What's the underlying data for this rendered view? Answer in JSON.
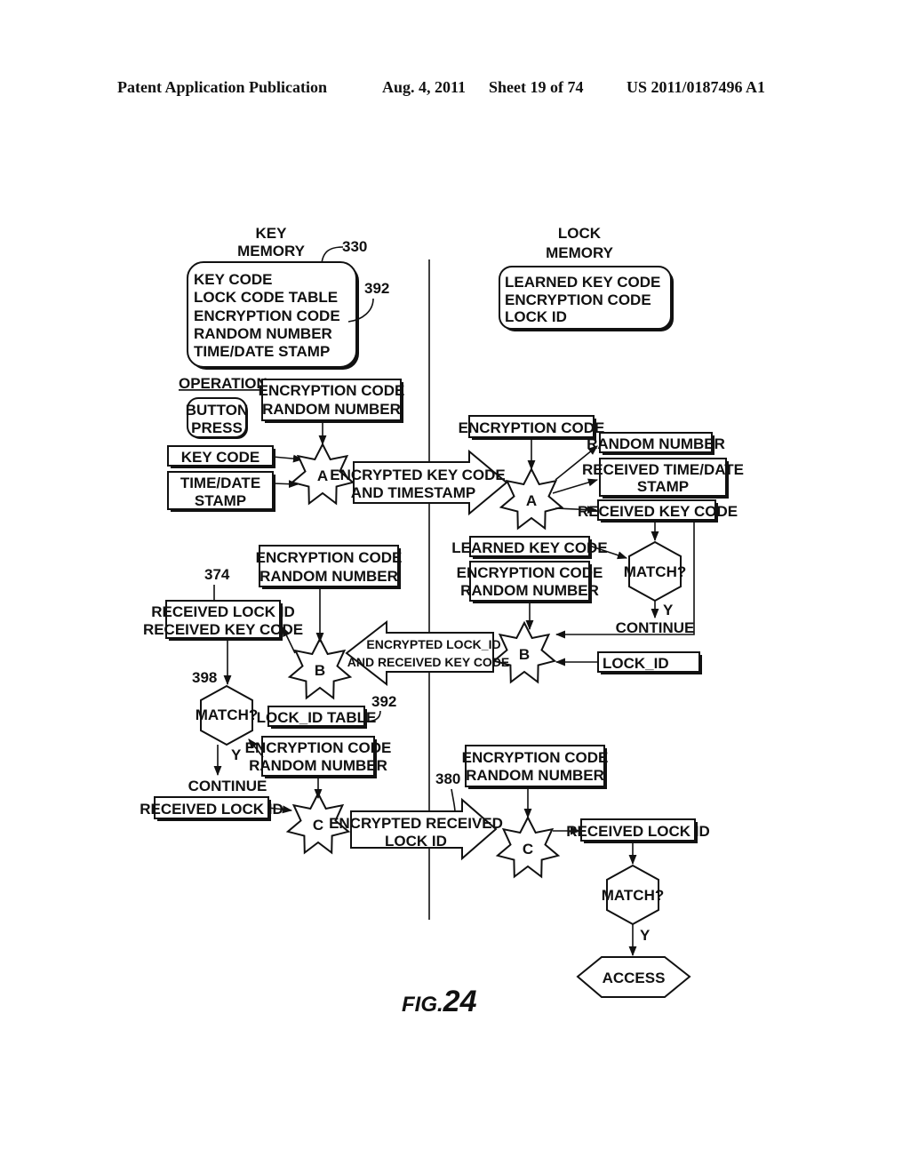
{
  "header": {
    "publication": "Patent Application Publication",
    "date": "Aug. 4, 2011",
    "sheet": "Sheet 19 of 74",
    "number": "US 2011/0187496 A1"
  },
  "figure": {
    "prefix": "FIG.",
    "number": "24"
  },
  "key_side": {
    "title1": "KEY",
    "title2": "MEMORY",
    "ref_memory": "330",
    "ref_table": "392",
    "memory_items": [
      "KEY CODE",
      "LOCK CODE TABLE",
      "ENCRYPTION CODE",
      "RANDOM NUMBER",
      "TIME/DATE STAMP"
    ],
    "operation_label": "OPERATION:",
    "button_press": [
      "BUTTON",
      "PRESS"
    ],
    "enc_rand_1": [
      "ENCRYPTION CODE",
      "RANDOM NUMBER"
    ],
    "key_code": "KEY CODE",
    "time_date": [
      "TIME/DATE",
      "STAMP"
    ],
    "star_a": "A",
    "ref_374": "374",
    "enc_rand_2": [
      "ENCRYPTION CODE",
      "RANDOM NUMBER"
    ],
    "received_box": [
      "RECEIVED LOCK ID",
      "RECEIVED KEY CODE"
    ],
    "star_b": "B",
    "ref_398": "398",
    "match": "MATCH?",
    "lock_id_table": "LOCK_ID TABLE",
    "ref_392b": "392",
    "enc_rand_3": [
      "ENCRYPTION CODE",
      "RANDOM NUMBER"
    ],
    "yes": "Y",
    "continue": "CONTINUE",
    "received_lock_id": "RECEIVED LOCK ID",
    "star_c": "C"
  },
  "lock_side": {
    "title1": "LOCK",
    "title2": "MEMORY",
    "memory_items": [
      "LEARNED KEY CODE",
      "ENCRYPTION CODE",
      "LOCK ID"
    ],
    "encryption_code": "ENCRYPTION CODE",
    "star_a": "A",
    "random_number": "RANDOM NUMBER",
    "received_time": [
      "RECEIVED TIME/DATE",
      "STAMP"
    ],
    "received_key_code": "RECEIVED KEY CODE",
    "learned_key_code": "LEARNED KEY CODE",
    "enc_rand_1": [
      "ENCRYPTION CODE",
      "RANDOM NUMBER"
    ],
    "match": "MATCH?",
    "yes": "Y",
    "continue": "CONTINUE",
    "star_b": "B",
    "lock_id": "LOCK_ID",
    "ref_380": "380",
    "enc_rand_2": [
      "ENCRYPTION CODE",
      "RANDOM NUMBER"
    ],
    "star_c": "C",
    "received_lock_id": "RECEIVED LOCK ID",
    "match2": "MATCH?",
    "yes2": "Y",
    "access": "ACCESS"
  },
  "transfers": {
    "a": [
      "ENCRYPTED KEY CODE",
      "AND TIMESTAMP"
    ],
    "b": [
      "ENCRYPTED LOCK_ID",
      "AND RECEIVED KEY CODE"
    ],
    "c": [
      "ENCRYPTED RECEIVED",
      "LOCK ID"
    ]
  }
}
